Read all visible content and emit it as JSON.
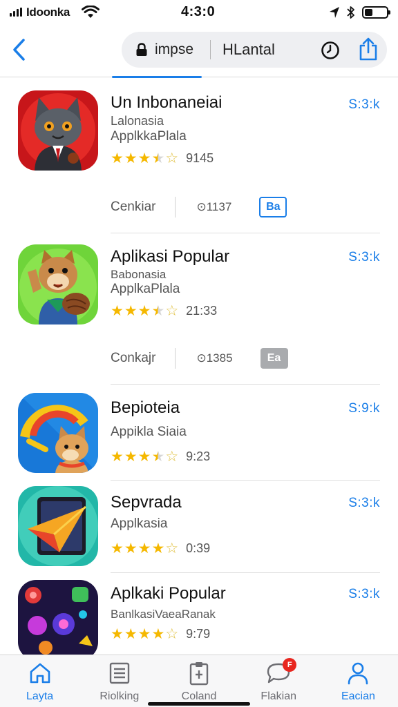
{
  "status_bar": {
    "carrier": "Idoonka",
    "time": "4:3:0",
    "battery_level": 0.35,
    "icons": [
      "signal-icon",
      "wifi-icon",
      "location-arrow-icon",
      "bluetooth-icon",
      "battery-icon"
    ]
  },
  "nav": {
    "search_left": "impse",
    "search_right": "HLantal",
    "icons": [
      "back-chevron-icon",
      "lock-icon",
      "clock-icon",
      "share-icon"
    ]
  },
  "apps": [
    {
      "name": "Un Inbonaneiai",
      "subtitle1": "Lalonasia",
      "subtitle2": "ApplkkaPlala",
      "stars": 3.5,
      "rating_count": "9145",
      "get_label": "S:3:k",
      "meta": {
        "label": "Cenkiar",
        "stat": "⊙1137",
        "badge": "Ba",
        "badge_style": "outline"
      },
      "icon": "cat-character-icon",
      "accent": "#d91e1e"
    },
    {
      "name": "Aplikasi Popular",
      "subtitle1": "Babonasia",
      "subtitle2": "ApplkaPlala",
      "stars": 3.5,
      "rating_count": "21:33",
      "get_label": "S:3:k",
      "meta": {
        "label": "Conkajr",
        "stat": "⊙1385",
        "badge": "Ea",
        "badge_style": "grey"
      },
      "icon": "fox-character-icon",
      "accent": "#5ccc2e"
    },
    {
      "name": "Bepioteia",
      "subtitle1": "Appikla Siaia",
      "subtitle2": "",
      "stars": 3.5,
      "rating_count": "9:23",
      "get_label": "S:9:k",
      "meta": null,
      "icon": "dog-gauge-icon",
      "accent": "#1c86e0"
    },
    {
      "name": "Sepvrada",
      "subtitle1": "Applkasia",
      "subtitle2": "",
      "stars": 4,
      "rating_count": "0:39",
      "get_label": "S:3:k",
      "meta": null,
      "icon": "arrow-tablet-icon",
      "accent": "#2bbfb3"
    },
    {
      "name": "Aplkaki Popular",
      "subtitle1": "BanlkasiVaeaRanak",
      "subtitle2": "",
      "stars": 4,
      "rating_count": "9:79",
      "get_label": "S:3:k",
      "meta": null,
      "icon": "candy-game-icon",
      "accent": "#1f1645"
    }
  ],
  "tabs": [
    {
      "label": "Layta",
      "icon": "home-icon",
      "active": true,
      "badge": ""
    },
    {
      "label": "Riolking",
      "icon": "list-icon",
      "active": false,
      "badge": ""
    },
    {
      "label": "Coland",
      "icon": "clipboard-icon",
      "active": false,
      "badge": ""
    },
    {
      "label": "Flakian",
      "icon": "chat-bubble-icon",
      "active": false,
      "badge": "F"
    },
    {
      "label": "Eacian",
      "icon": "person-icon",
      "active": true,
      "badge": ""
    }
  ]
}
